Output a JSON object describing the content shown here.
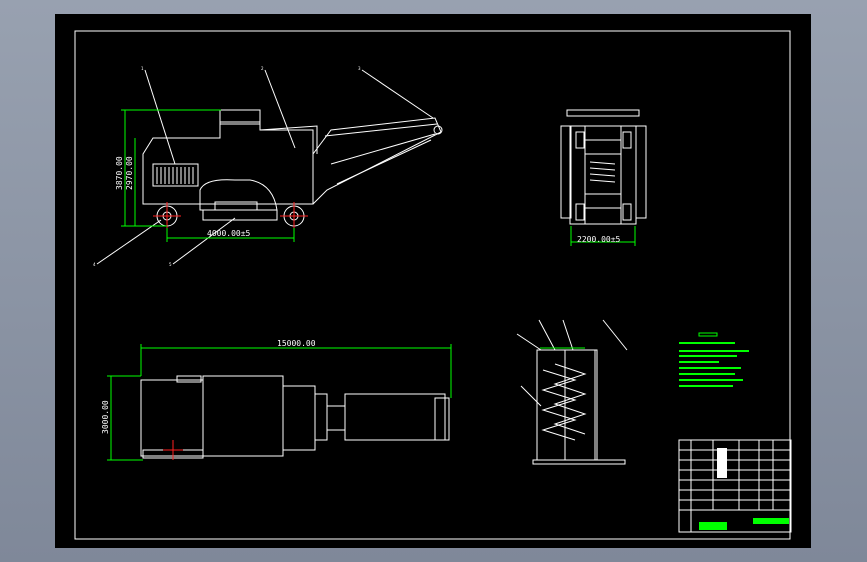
{
  "colors": {
    "background": "#000000",
    "geometry": "#ffffff",
    "dimensions": "#00ff00",
    "centerlines": "#ff2020"
  },
  "side_view": {
    "dim_height_outer": "3870.00",
    "dim_height_inner": "2970.00",
    "dim_wheelbase": "4000.00±5"
  },
  "end_view": {
    "dim_width": "2200.00±5"
  },
  "plan_view": {
    "dim_length": "15000.00",
    "dim_width": "3000.00"
  }
}
